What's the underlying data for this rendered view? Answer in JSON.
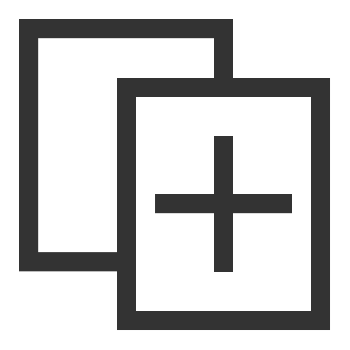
{
  "icon": {
    "name": "duplicate-add-icon",
    "stroke_color": "#333333",
    "background_color": "#ffffff"
  }
}
